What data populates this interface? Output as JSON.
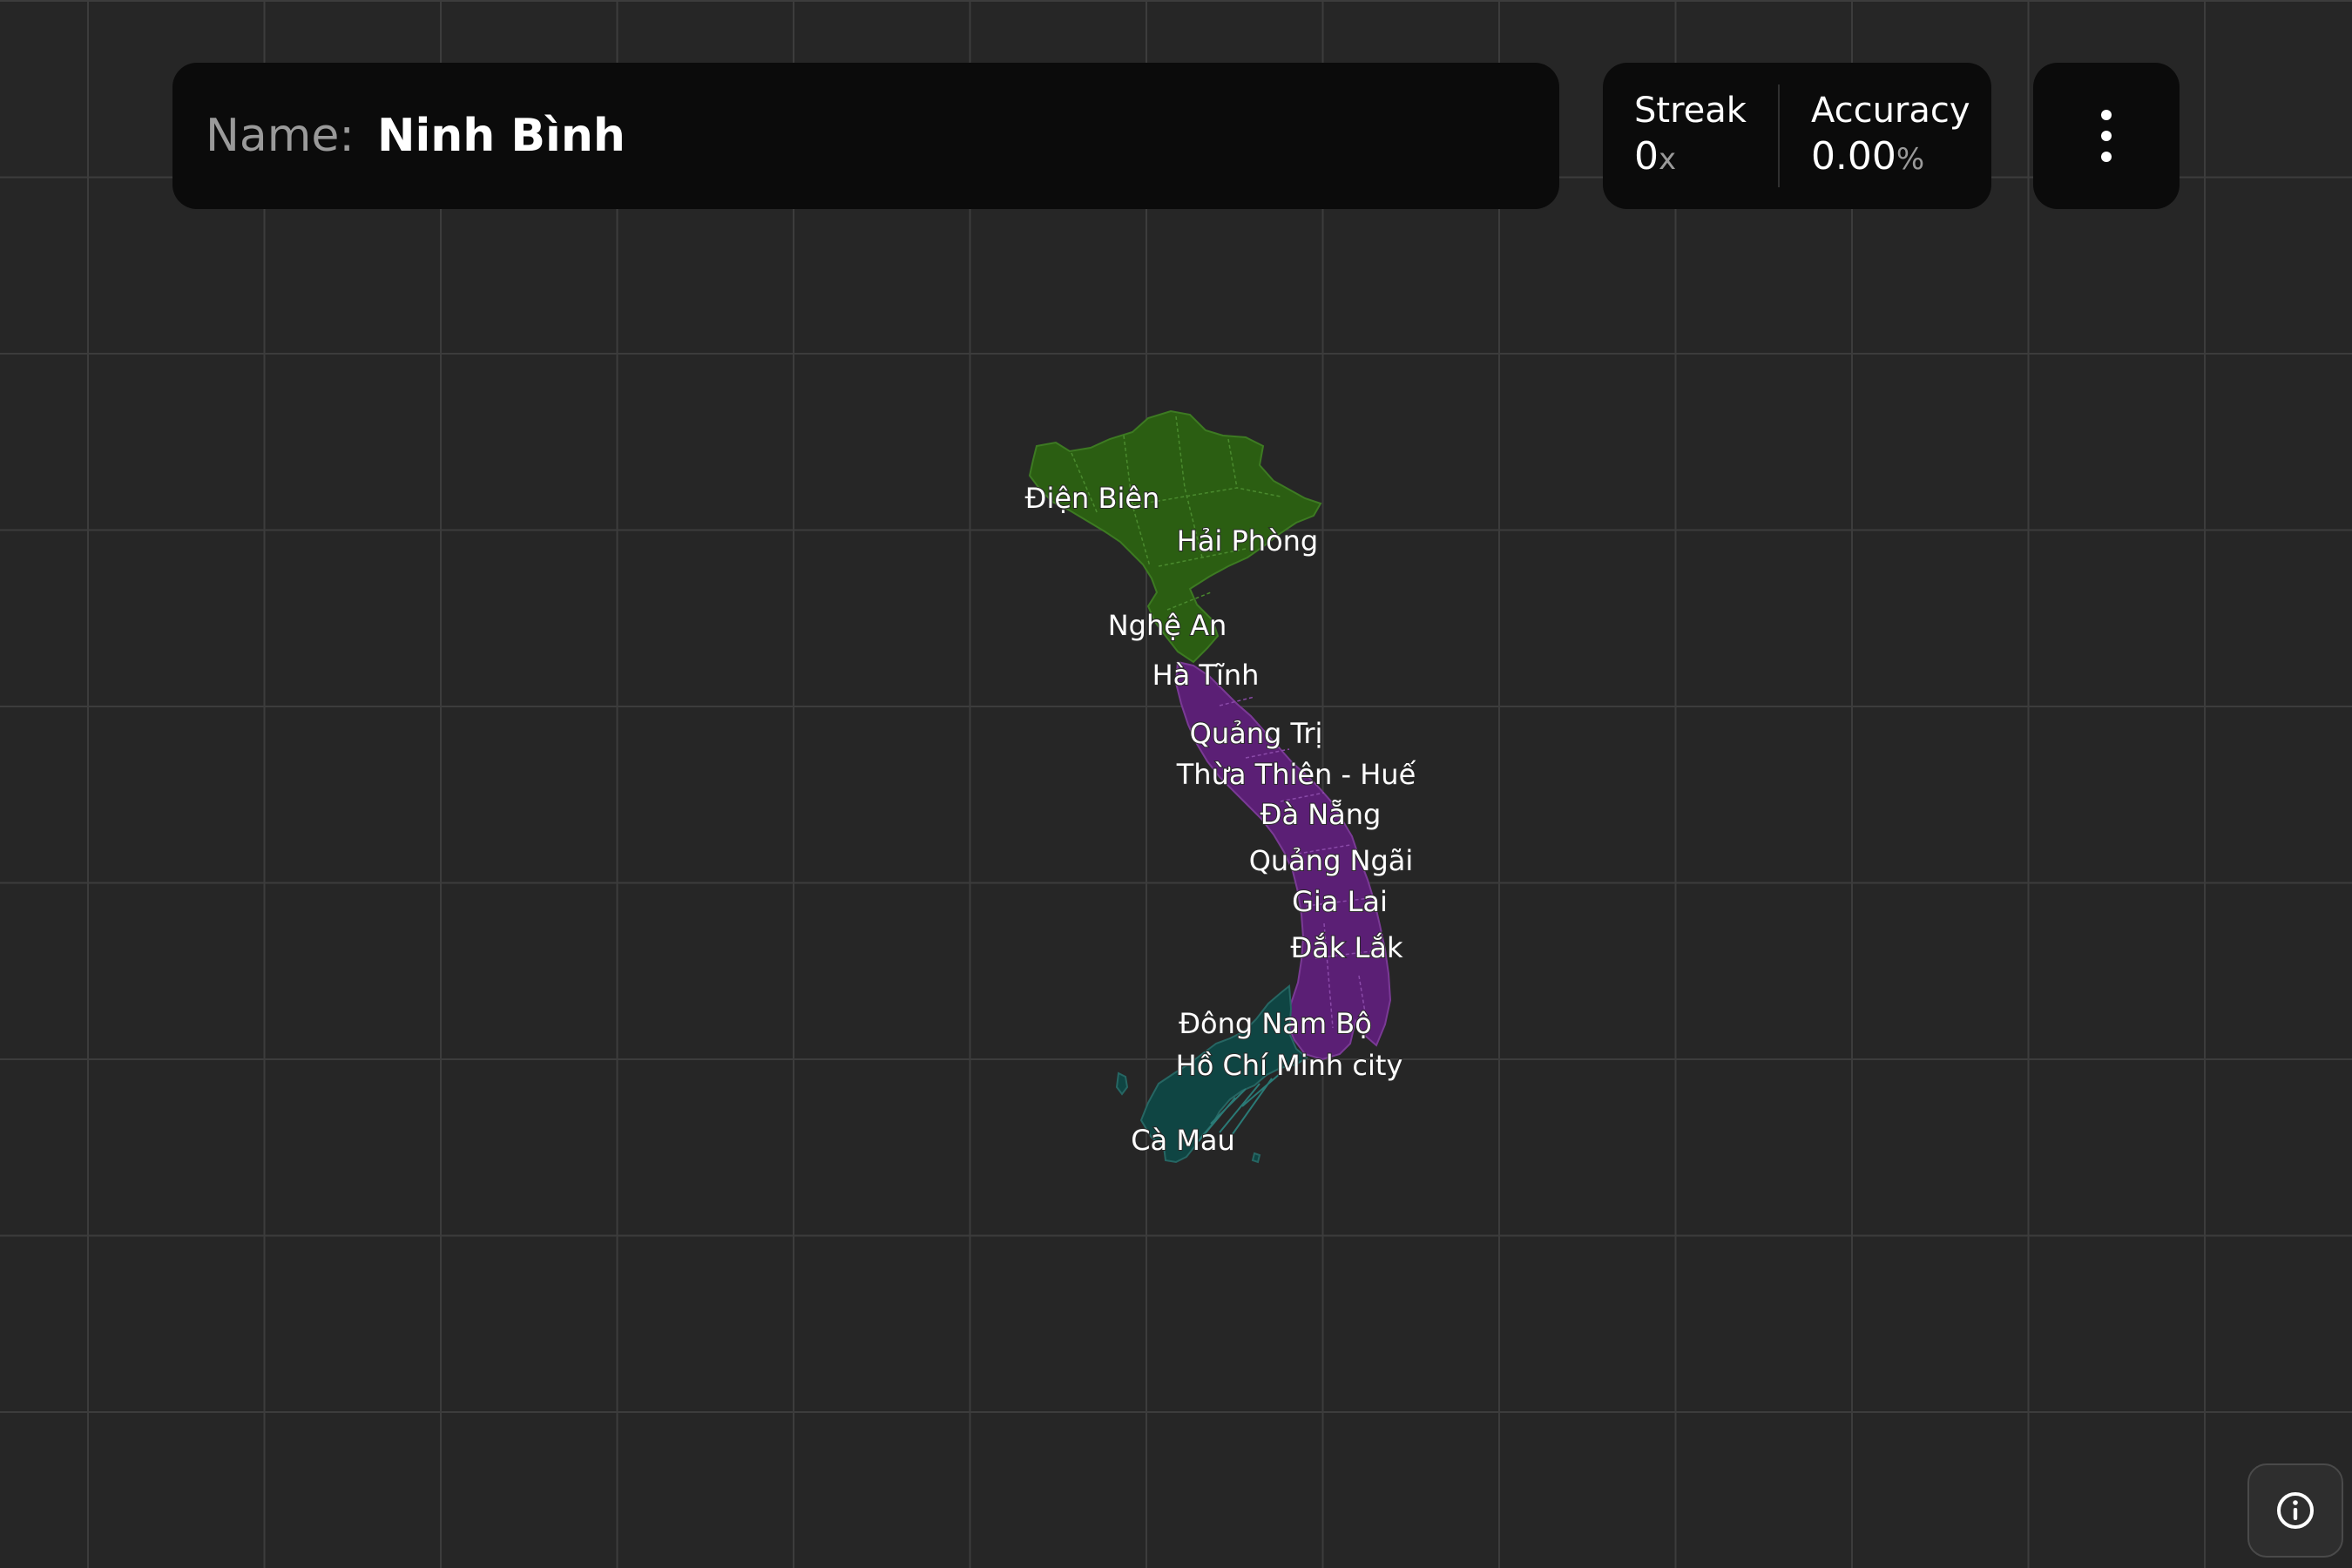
{
  "header": {
    "name_label": "Name:",
    "name_value": "Ninh Bình"
  },
  "stats": {
    "streak": {
      "label": "Streak",
      "value": "0",
      "unit": "x"
    },
    "accuracy": {
      "label": "Accuracy",
      "value": "0.00",
      "unit": "%"
    }
  },
  "menu": {
    "icon": "more-vertical-icon"
  },
  "info": {
    "icon": "info-icon"
  },
  "colors": {
    "background": "#262626",
    "panel": "#0b0b0b",
    "north": "#2b5e12",
    "central": "#5b1f75",
    "south": "#0f4543"
  },
  "map": {
    "labels": [
      "Điện Biên",
      "Hải Phòng",
      "Nghệ An",
      "Hà Tĩnh",
      "Quảng Trị",
      "Thừa Thiên - Huế",
      "Đà Nẵng",
      "Quảng Ngãi",
      "Gia Lai",
      "Đắk Lắk",
      "Đông Nam Bộ",
      "Hồ Chí Minh city",
      "Cà Mau"
    ]
  }
}
